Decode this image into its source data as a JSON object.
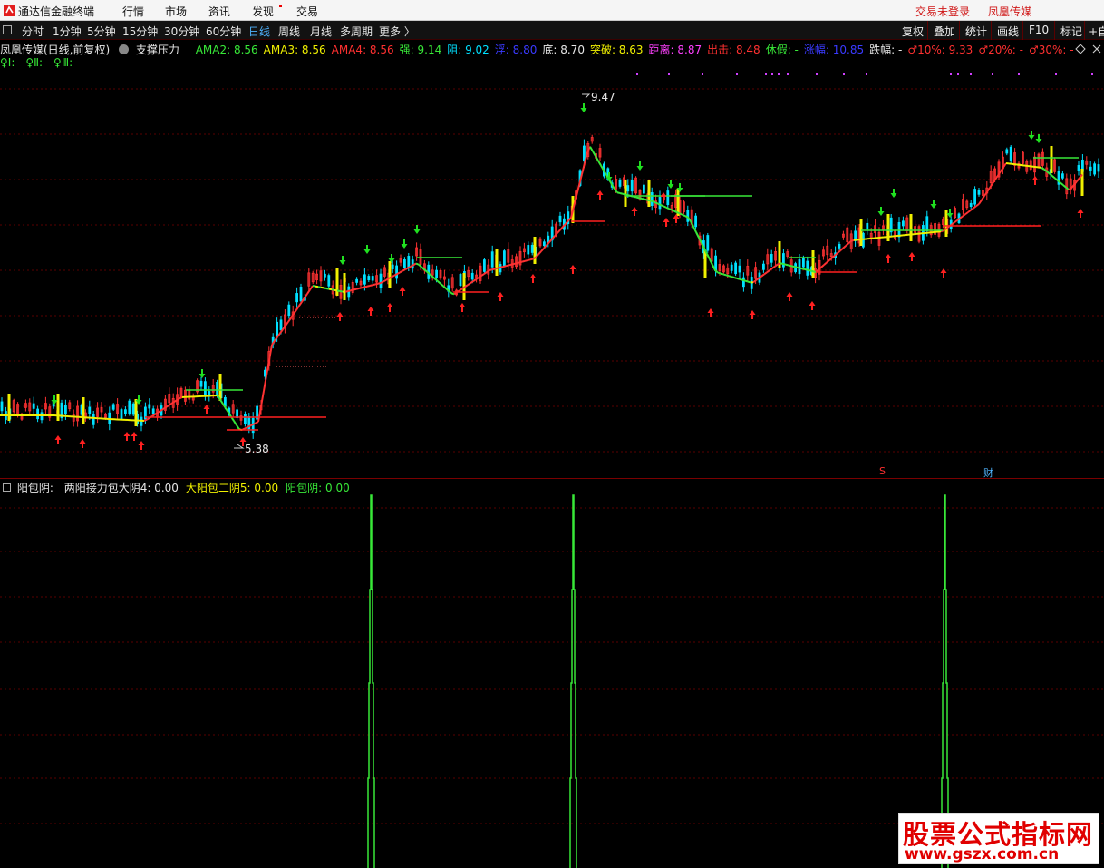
{
  "menubar": {
    "app_title": "通达信金融终端",
    "items": [
      "行情",
      "市场",
      "资讯",
      "发现",
      "交易"
    ],
    "trade_status": "交易未登录",
    "username": "凤凰传媒"
  },
  "toolbar": {
    "periods": [
      "分时",
      "1分钟",
      "5分钟",
      "15分钟",
      "30分钟",
      "60分钟",
      "日线",
      "周线",
      "月线",
      "多周期",
      "更多 〉"
    ],
    "active_period": "日线",
    "right_buttons": [
      "复权",
      "叠加",
      "统计",
      "画线",
      "F10",
      "标记",
      "+自"
    ]
  },
  "main_chart": {
    "stock_label": "凤凰传媒(日线,前复权)",
    "indicator_name": "支撑压力",
    "fields": [
      {
        "label": "AMA2: 8.56",
        "color": "#38e838"
      },
      {
        "label": "AMA3: 8.56",
        "color": "#f0f000"
      },
      {
        "label": "AMA4: 8.56",
        "color": "#ff3030"
      },
      {
        "label": "强: 9.14",
        "color": "#38e838"
      },
      {
        "label": "阻: 9.02",
        "color": "#00e0ff"
      },
      {
        "label": "浮: 8.80",
        "color": "#3a3aff"
      },
      {
        "label": "底: 8.70",
        "color": "#e6e6e6"
      },
      {
        "label": "突破: 8.63",
        "color": "#f0f000"
      },
      {
        "label": "距离: 8.87",
        "color": "#ff40ff"
      },
      {
        "label": "出击: 8.48",
        "color": "#ff3030"
      },
      {
        "label": "休假: -",
        "color": "#38e838"
      },
      {
        "label": "涨幅: 10.85",
        "color": "#3a3aff"
      },
      {
        "label": "跌幅: -",
        "color": "#e6e6e6"
      },
      {
        "label": "♂10%: 9.33",
        "color": "#ff3030"
      },
      {
        "label": "♂20%: -",
        "color": "#ff3030"
      },
      {
        "label": "♂30%: -",
        "color": "#ff3030"
      }
    ],
    "second_line": "♀Ⅰ: - ♀Ⅱ: - ♀Ⅲ: -",
    "high_label": "9.47",
    "low_label": "5.38",
    "bottom_marker_s": "S",
    "bottom_marker_cai": "财"
  },
  "sub_chart": {
    "name": "阳包阴:",
    "fields": [
      {
        "label": "两阳接力包大阴4: 0.00",
        "color": "#e6e6e6"
      },
      {
        "label": "大阳包二阴5: 0.00",
        "color": "#f0f000"
      },
      {
        "label": "阳包阴: 0.00",
        "color": "#38e838"
      }
    ]
  },
  "colors": {
    "up": "#ff3232",
    "down": "#00e0ff",
    "signal": "#38e838",
    "grid": "#5a0000",
    "mid": "#f0f000"
  },
  "watermark": {
    "title": "股票公式指标网",
    "url": "www.gszx.com.cn"
  }
}
